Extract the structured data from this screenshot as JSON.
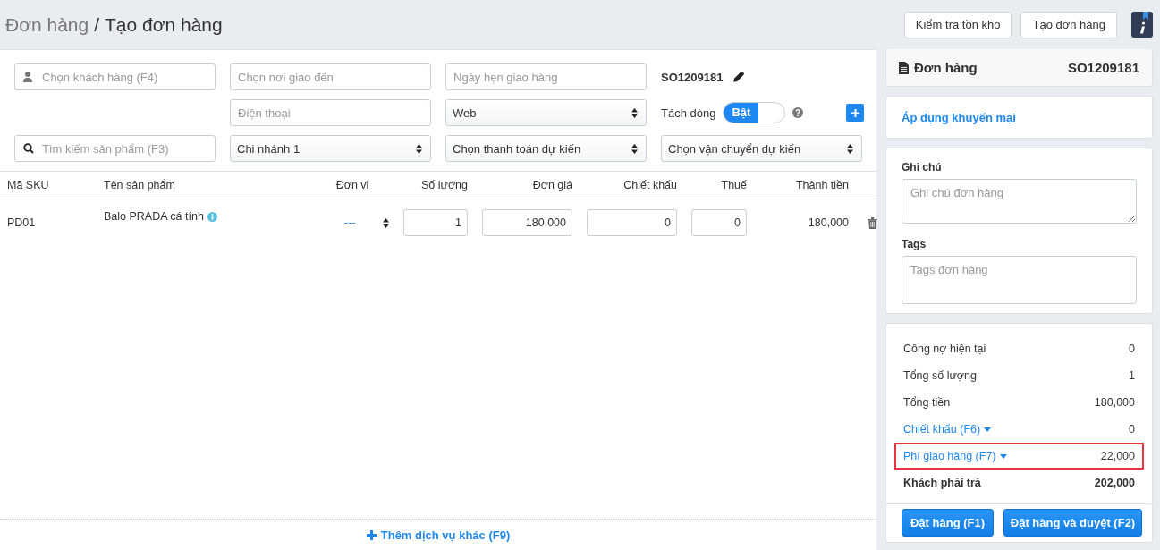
{
  "breadcrumb": {
    "parent": "Đơn hàng",
    "separator": "/",
    "current": "Tạo đơn hàng"
  },
  "header_buttons": [
    "Kiểm tra tồn kho",
    "Tạo đơn hàng"
  ],
  "form": {
    "customer": {
      "placeholder": "Chọn khách hàng (F4)"
    },
    "delivery_place": {
      "placeholder": "Chọn nơi giao đến"
    },
    "delivery_date": {
      "placeholder": "Ngày hẹn giao hàng"
    },
    "order_code": "SO1209181",
    "phone": {
      "placeholder": "Điện thoại"
    },
    "source": "Web",
    "split_lines": {
      "label": "Tách dòng",
      "toggle_label": "Bật",
      "on": true
    },
    "product_search": {
      "placeholder": "Tìm kiếm sản phẩm (F3)"
    },
    "branch": "Chi nhánh 1",
    "payment": "Chọn thanh toán dự kiến",
    "shipping": "Chọn vận chuyển dự kiến"
  },
  "table": {
    "columns": [
      "Mã SKU",
      "Tên sản phẩm",
      "Đơn vị",
      "Số lượng",
      "Đơn giá",
      "Chiết khấu",
      "Thuế",
      "Thành tiền"
    ],
    "rows": [
      {
        "sku": "PD01",
        "name": "Balo PRADA cá tính",
        "unit": "---",
        "quantity": "1",
        "price": "180,000",
        "discount": "0",
        "tax": "0",
        "total": "180,000"
      }
    ]
  },
  "add_service": "Thêm dịch vụ khác (F9)",
  "order_card": {
    "title": "Đơn hàng",
    "code": "SO1209181"
  },
  "promotion_link": "Áp dụng khuyến mại",
  "notes": {
    "label": "Ghi chú",
    "placeholder": "Ghi chú đơn hàng"
  },
  "tags": {
    "label": "Tags",
    "placeholder": "Tags đơn hàng"
  },
  "summary": [
    {
      "kind": "plain",
      "label": "Công nợ hiện tại",
      "value": "0",
      "highlighted": false
    },
    {
      "kind": "plain",
      "label": "Tổng số lượng",
      "value": "1",
      "highlighted": false
    },
    {
      "kind": "plain",
      "label": "Tổng tiền",
      "value": "180,000",
      "highlighted": false
    },
    {
      "kind": "dropdown",
      "label": "Chiết khấu (F6)",
      "value": "0",
      "highlighted": false
    },
    {
      "kind": "dropdown",
      "label": "Phí giao hàng (F7)",
      "value": "22,000",
      "highlighted": true
    },
    {
      "kind": "total",
      "label": "Khách phải trả",
      "value": "202,000",
      "highlighted": false
    }
  ],
  "actions": [
    "Đặt hàng (F1)",
    "Đặt hàng và duyệt (F2)"
  ]
}
